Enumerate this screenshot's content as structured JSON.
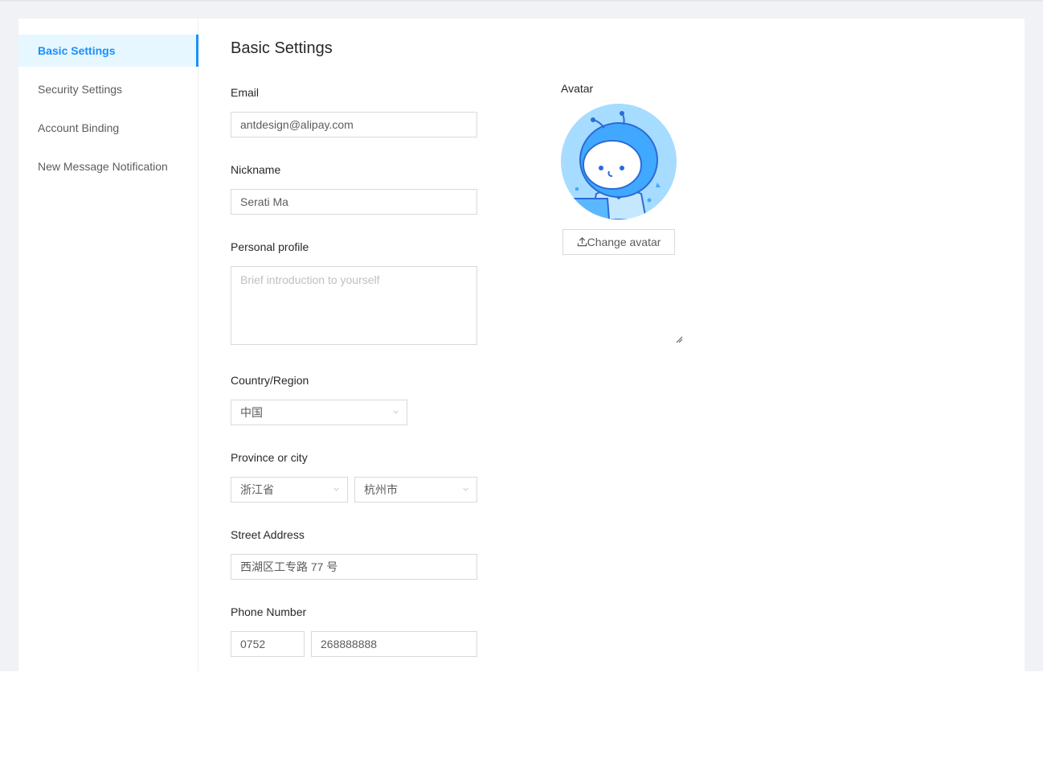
{
  "menu": {
    "items": [
      {
        "label": "Basic Settings",
        "active": true
      },
      {
        "label": "Security Settings",
        "active": false
      },
      {
        "label": "Account Binding",
        "active": false
      },
      {
        "label": "New Message Notification",
        "active": false
      }
    ]
  },
  "form": {
    "title": "Basic Settings",
    "email": {
      "label": "Email",
      "value": "antdesign@alipay.com"
    },
    "nickname": {
      "label": "Nickname",
      "value": "Serati Ma"
    },
    "profile": {
      "label": "Personal profile",
      "placeholder": "Brief introduction to yourself"
    },
    "country": {
      "label": "Country/Region",
      "value": "中国"
    },
    "province_city": {
      "label": "Province or city",
      "province": "浙江省",
      "city": "杭州市"
    },
    "street": {
      "label": "Street Address",
      "value": "西湖区工专路 77 号"
    },
    "phone": {
      "label": "Phone Number",
      "area_code": "0752",
      "number": "268888888"
    }
  },
  "avatar": {
    "label": "Avatar",
    "button_label": "Change avatar",
    "button_icon": "upload-icon"
  },
  "colors": {
    "primary": "#1890ff",
    "active_bg": "#e6f7ff",
    "page_bg": "#f0f2f5"
  }
}
